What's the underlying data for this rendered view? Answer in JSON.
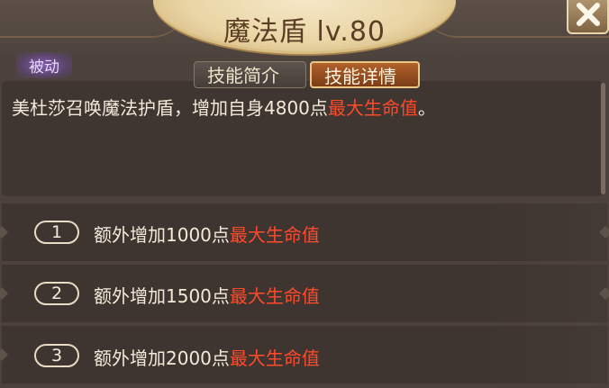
{
  "skill": {
    "title": "魔法盾 lv.80",
    "type_label": "被动"
  },
  "tabs": [
    {
      "label": "技能简介",
      "active": false
    },
    {
      "label": "技能详情",
      "active": true
    }
  ],
  "description": {
    "text": "美杜莎召唤魔法护盾，增加自身4800点",
    "highlight": "最大生命值",
    "suffix": "。"
  },
  "bonuses": [
    {
      "index": "1",
      "text": "额外增加1000点",
      "highlight": "最大生命值"
    },
    {
      "index": "2",
      "text": "额外增加1500点",
      "highlight": "最大生命值"
    },
    {
      "index": "3",
      "text": "额外增加2000点",
      "highlight": "最大生命值"
    }
  ],
  "colors": {
    "highlight": "#ff4a2b",
    "active_tab": "#9a4f21",
    "title_plate": "#e9d5a5"
  },
  "icons": {
    "close": "close-icon"
  }
}
